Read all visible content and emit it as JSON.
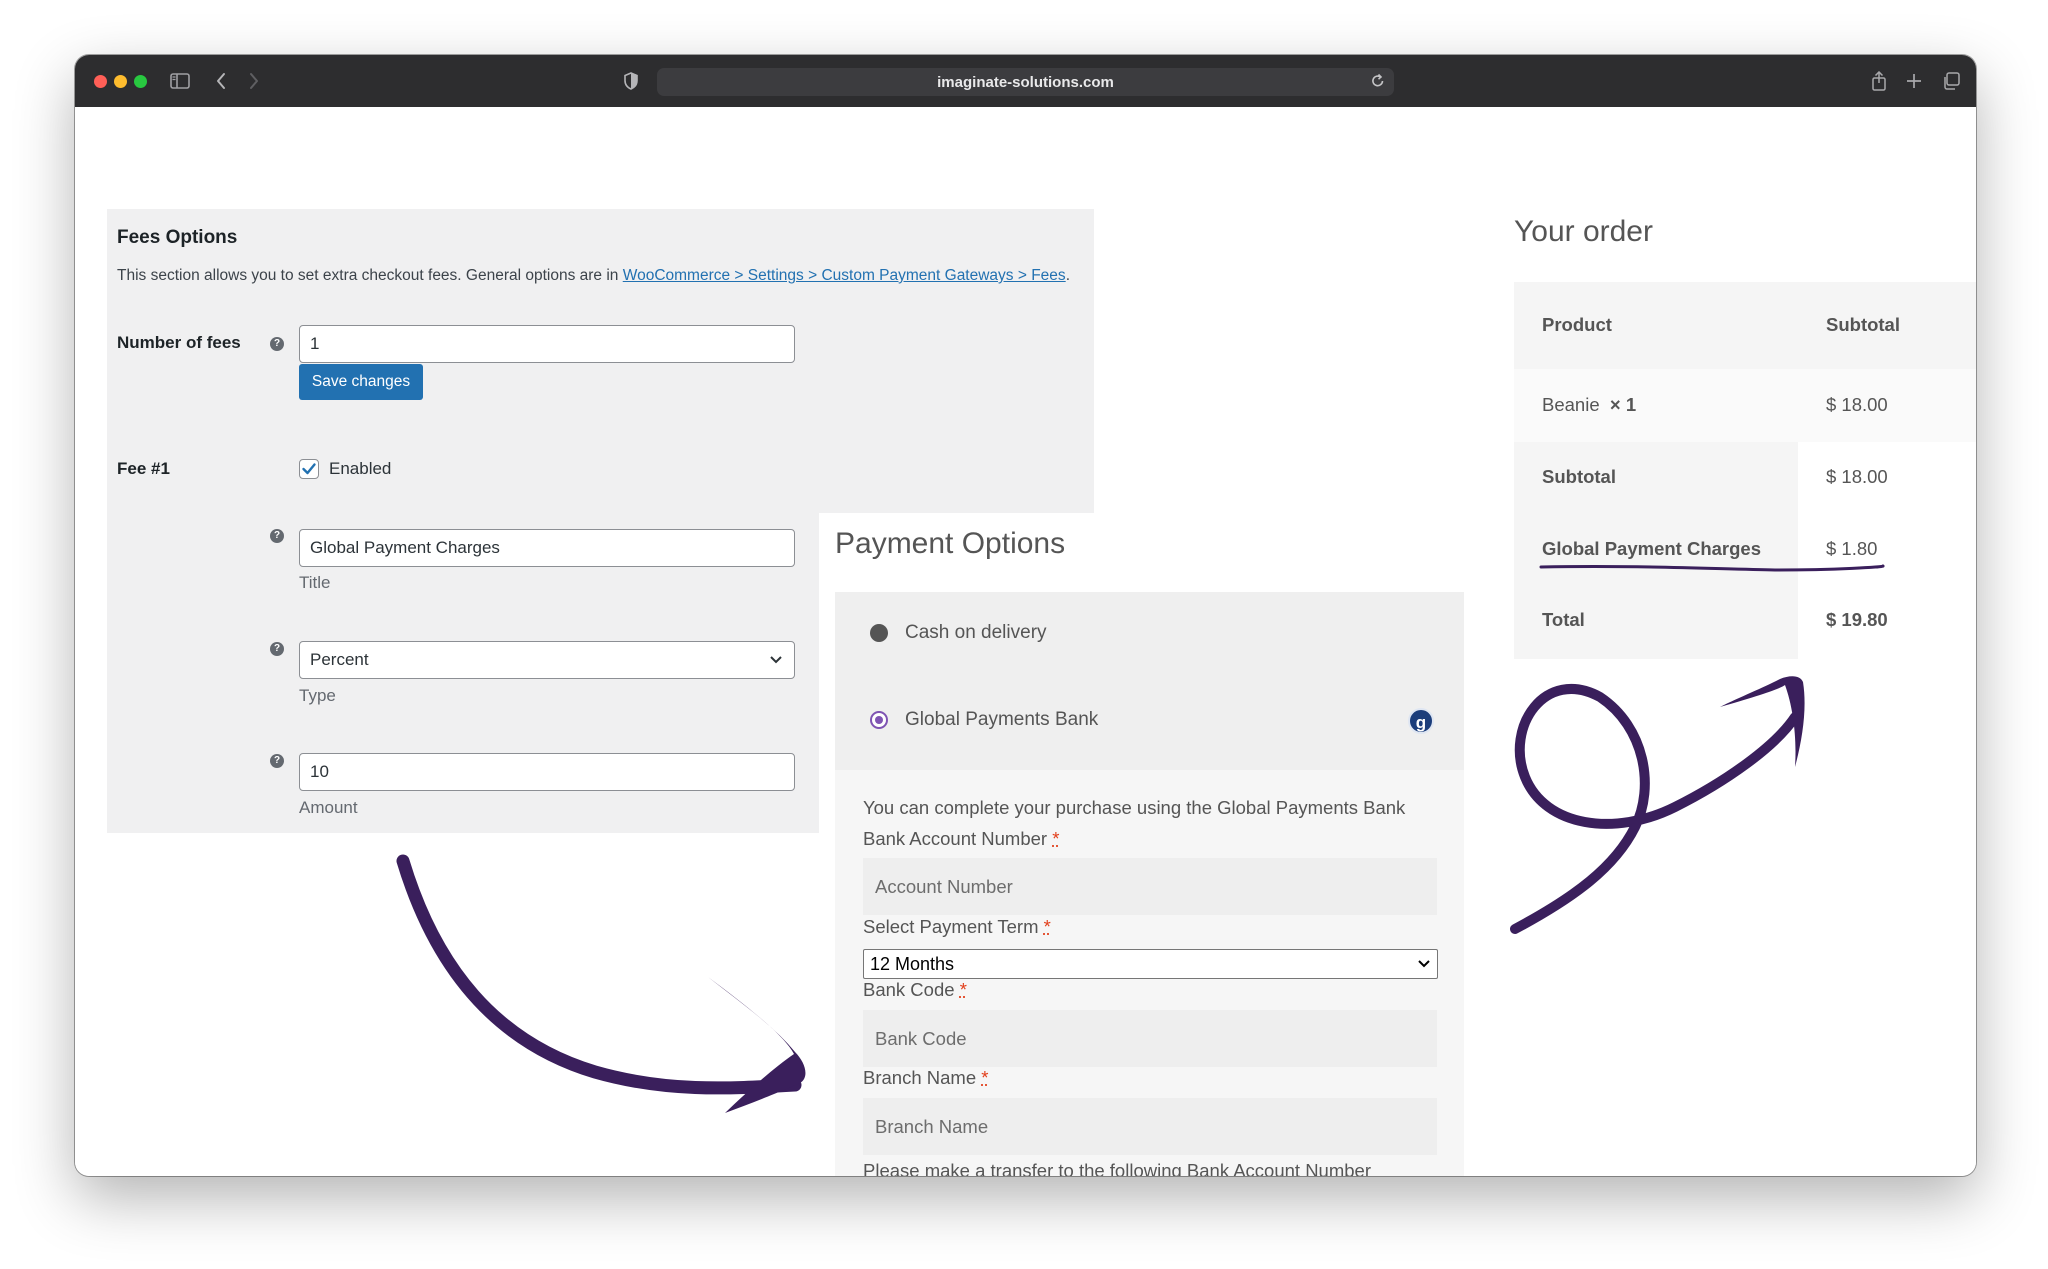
{
  "browser": {
    "url": "imaginate-solutions.com"
  },
  "fees": {
    "title": "Fees Options",
    "description": "This section allows you to set extra checkout fees. General options are in ",
    "link_text": "WooCommerce > Settings > Custom Payment Gateways > Fees",
    "description_end": ".",
    "number_of_fees_label": "Number of fees",
    "number_of_fees_value": "1",
    "save_label": "Save changes",
    "fee1_label": "Fee #1",
    "enabled_label": "Enabled",
    "enabled_checked": true,
    "title_value": "Global Payment Charges",
    "title_caption": "Title",
    "type_value": "Percent",
    "type_caption": "Type",
    "amount_value": "10",
    "amount_caption": "Amount"
  },
  "payment": {
    "heading": "Payment Options",
    "options": [
      {
        "label": "Cash on delivery",
        "selected": false
      },
      {
        "label": "Global Payments Bank",
        "selected": true
      }
    ],
    "logo_letter": "g",
    "intro": "You can complete your purchase using the Global Payments Bank",
    "account_label": "Bank Account Number",
    "account_placeholder": "Account Number",
    "term_label": "Select Payment Term",
    "term_value": "12 Months",
    "code_label": "Bank Code",
    "code_placeholder": "Bank Code",
    "branch_label": "Branch Name",
    "branch_placeholder": "Branch Name",
    "required_mark": "*",
    "footer": "Please make a transfer to the following Bank Account Number"
  },
  "order": {
    "heading": "Your order",
    "col_product": "Product",
    "col_subtotal": "Subtotal",
    "item_name": "Beanie",
    "item_qty": "× 1",
    "item_price": "$ 18.00",
    "subtotal_label": "Subtotal",
    "subtotal_value": "$ 18.00",
    "fee_label": "Global Payment Charges",
    "fee_value": "$ 1.80",
    "total_label": "Total",
    "total_value": "$ 19.80"
  },
  "colors": {
    "wp_blue": "#2271b1",
    "radio_purple": "#7f54b3",
    "annotation_purple": "#3a1f5c"
  },
  "icons": [
    "sidebar-icon",
    "back-icon",
    "forward-icon",
    "shield-icon",
    "reload-icon",
    "share-icon",
    "new-tab-icon",
    "tabs-icon",
    "help-icon",
    "chevron-down-icon",
    "checkmark-icon"
  ]
}
